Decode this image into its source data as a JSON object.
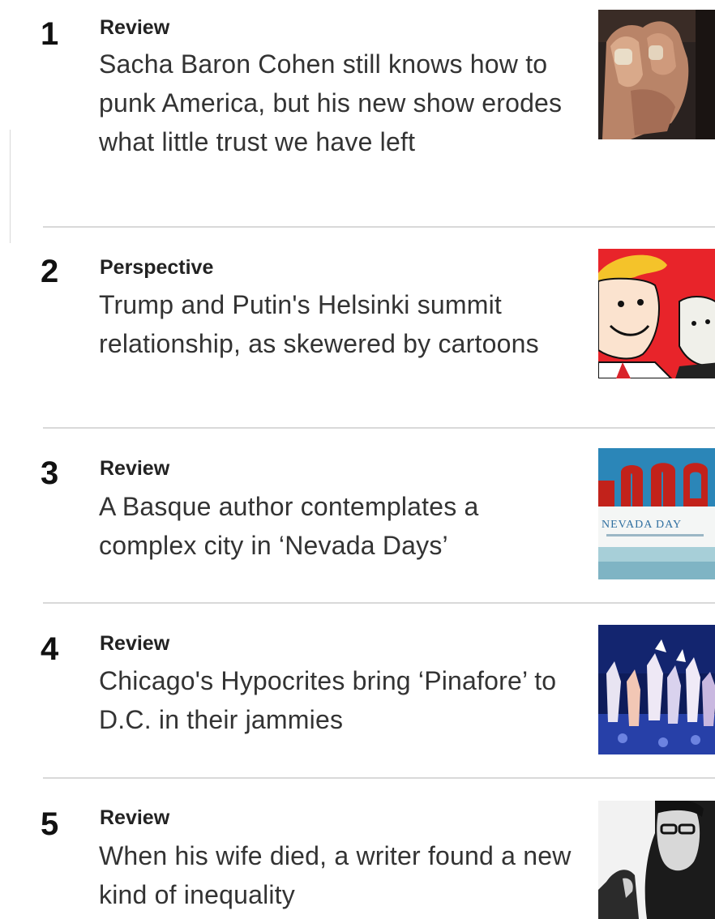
{
  "items": [
    {
      "rank": "1",
      "kicker": "Review",
      "headline": "Sacha Baron Cohen still knows how to punk America, but his new show erodes what little trust we have left"
    },
    {
      "rank": "2",
      "kicker": "Perspective",
      "headline": "Trump and Putin's Helsinki summit relationship, as skewered by cartoons"
    },
    {
      "rank": "3",
      "kicker": "Review",
      "headline": "A Basque author contemplates a complex city in ‘Nevada Days’",
      "thumb_text": "NEVADA DAY"
    },
    {
      "rank": "4",
      "kicker": "Review",
      "headline": "Chicago's Hypocrites bring ‘Pinafore’ to D.C. in their jammies"
    },
    {
      "rank": "5",
      "kicker": "Review",
      "headline": "When his wife died, a writer found a new kind of inequality"
    }
  ]
}
